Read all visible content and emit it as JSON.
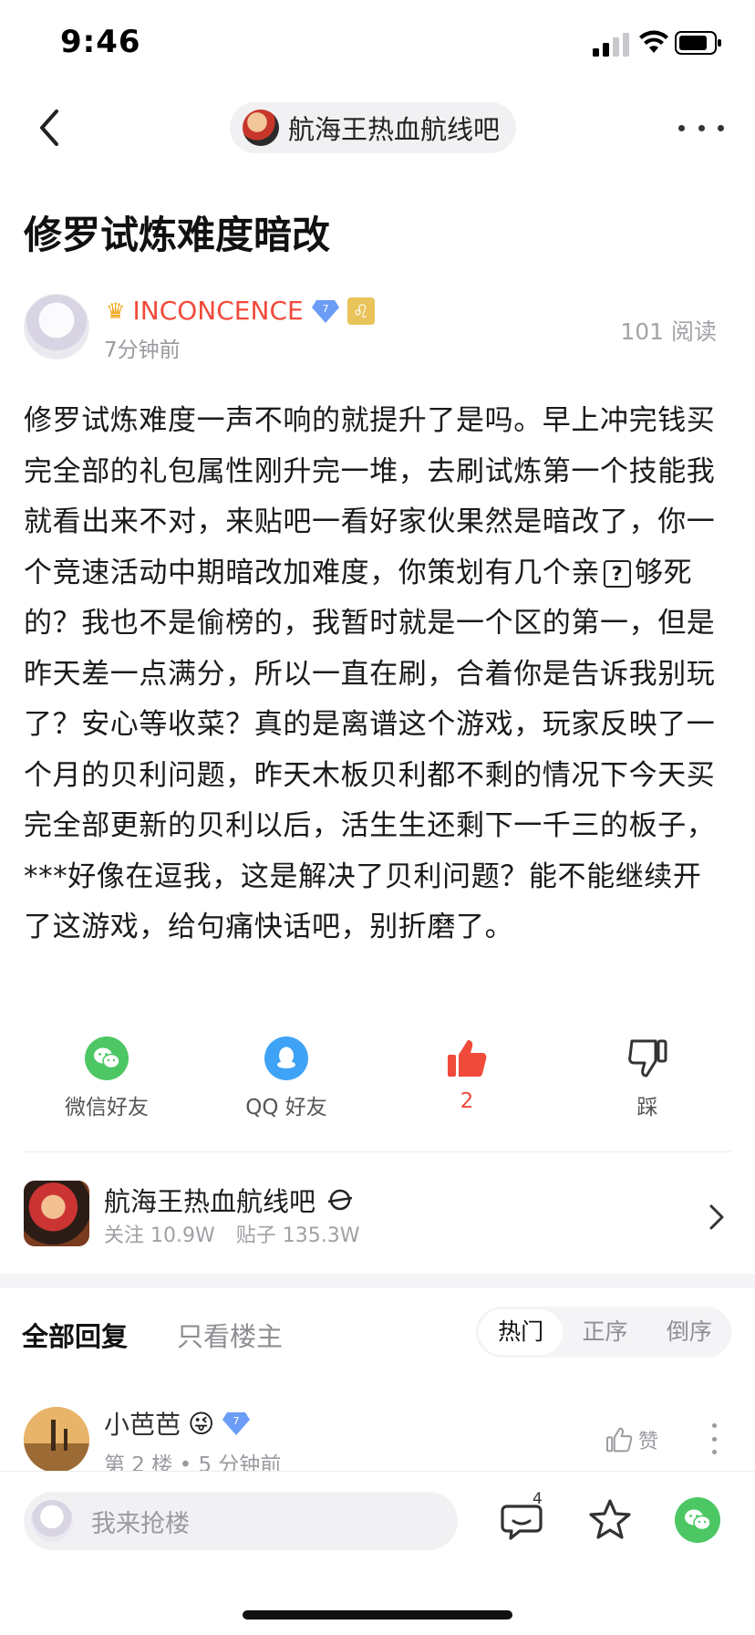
{
  "status": {
    "time": "9:46"
  },
  "nav": {
    "forum_title": "航海王热血航线吧"
  },
  "post": {
    "title": "修罗试炼难度暗改",
    "author": {
      "name": "INCONCENCE",
      "level": "7",
      "zodiac": "♌",
      "time": "7分钟前"
    },
    "reads": "101 阅读",
    "body_before_emoji": "修罗试炼难度一声不响的就提升了是吗。早上冲完钱买完全部的礼包属性刚升完一堆，去刷试炼第一个技能我就看出来不对，来贴吧一看好家伙果然是暗改了，你一个竞速活动中期暗改加难度，你策划有几个亲",
    "emoji": "?",
    "body_after_emoji": "够死的？我也不是偷榜的，我暂时就是一个区的第一，但是昨天差一点满分，所以一直在刷，合着你是告诉我别玩了？安心等收菜？真的是离谱这个游戏，玩家反映了一个月的贝利问题，昨天木板贝利都不剩的情况下今天买完全部更新的贝利以后，活生生还剩下一千三的板子，***好像在逗我，这是解决了贝利问题？能不能继续开了这游戏，给句痛快话吧，别折磨了。"
  },
  "actions": {
    "wechat": "微信好友",
    "qq": "QQ 好友",
    "like_count": "2",
    "dislike": "踩"
  },
  "forum_card": {
    "name": "航海王热血航线吧",
    "followers": "关注 10.9W",
    "posts": "贴子 135.3W"
  },
  "replies": {
    "tab_all": "全部回复",
    "tab_op": "只看楼主",
    "sort": {
      "hot": "热门",
      "asc": "正序",
      "desc": "倒序"
    },
    "items": [
      {
        "name": "小芭芭",
        "emoji": "😜",
        "level": "7",
        "meta": "第 2 楼 • 5 分钟前",
        "like_label": "赞"
      }
    ]
  },
  "bottom": {
    "placeholder": "我来抢楼",
    "comment_count": "4"
  },
  "colors": {
    "accent_red": "#f04a3a",
    "wechat_green": "#4cc764",
    "qq_blue": "#3ea3f6",
    "level_blue": "#6b9cf6"
  }
}
